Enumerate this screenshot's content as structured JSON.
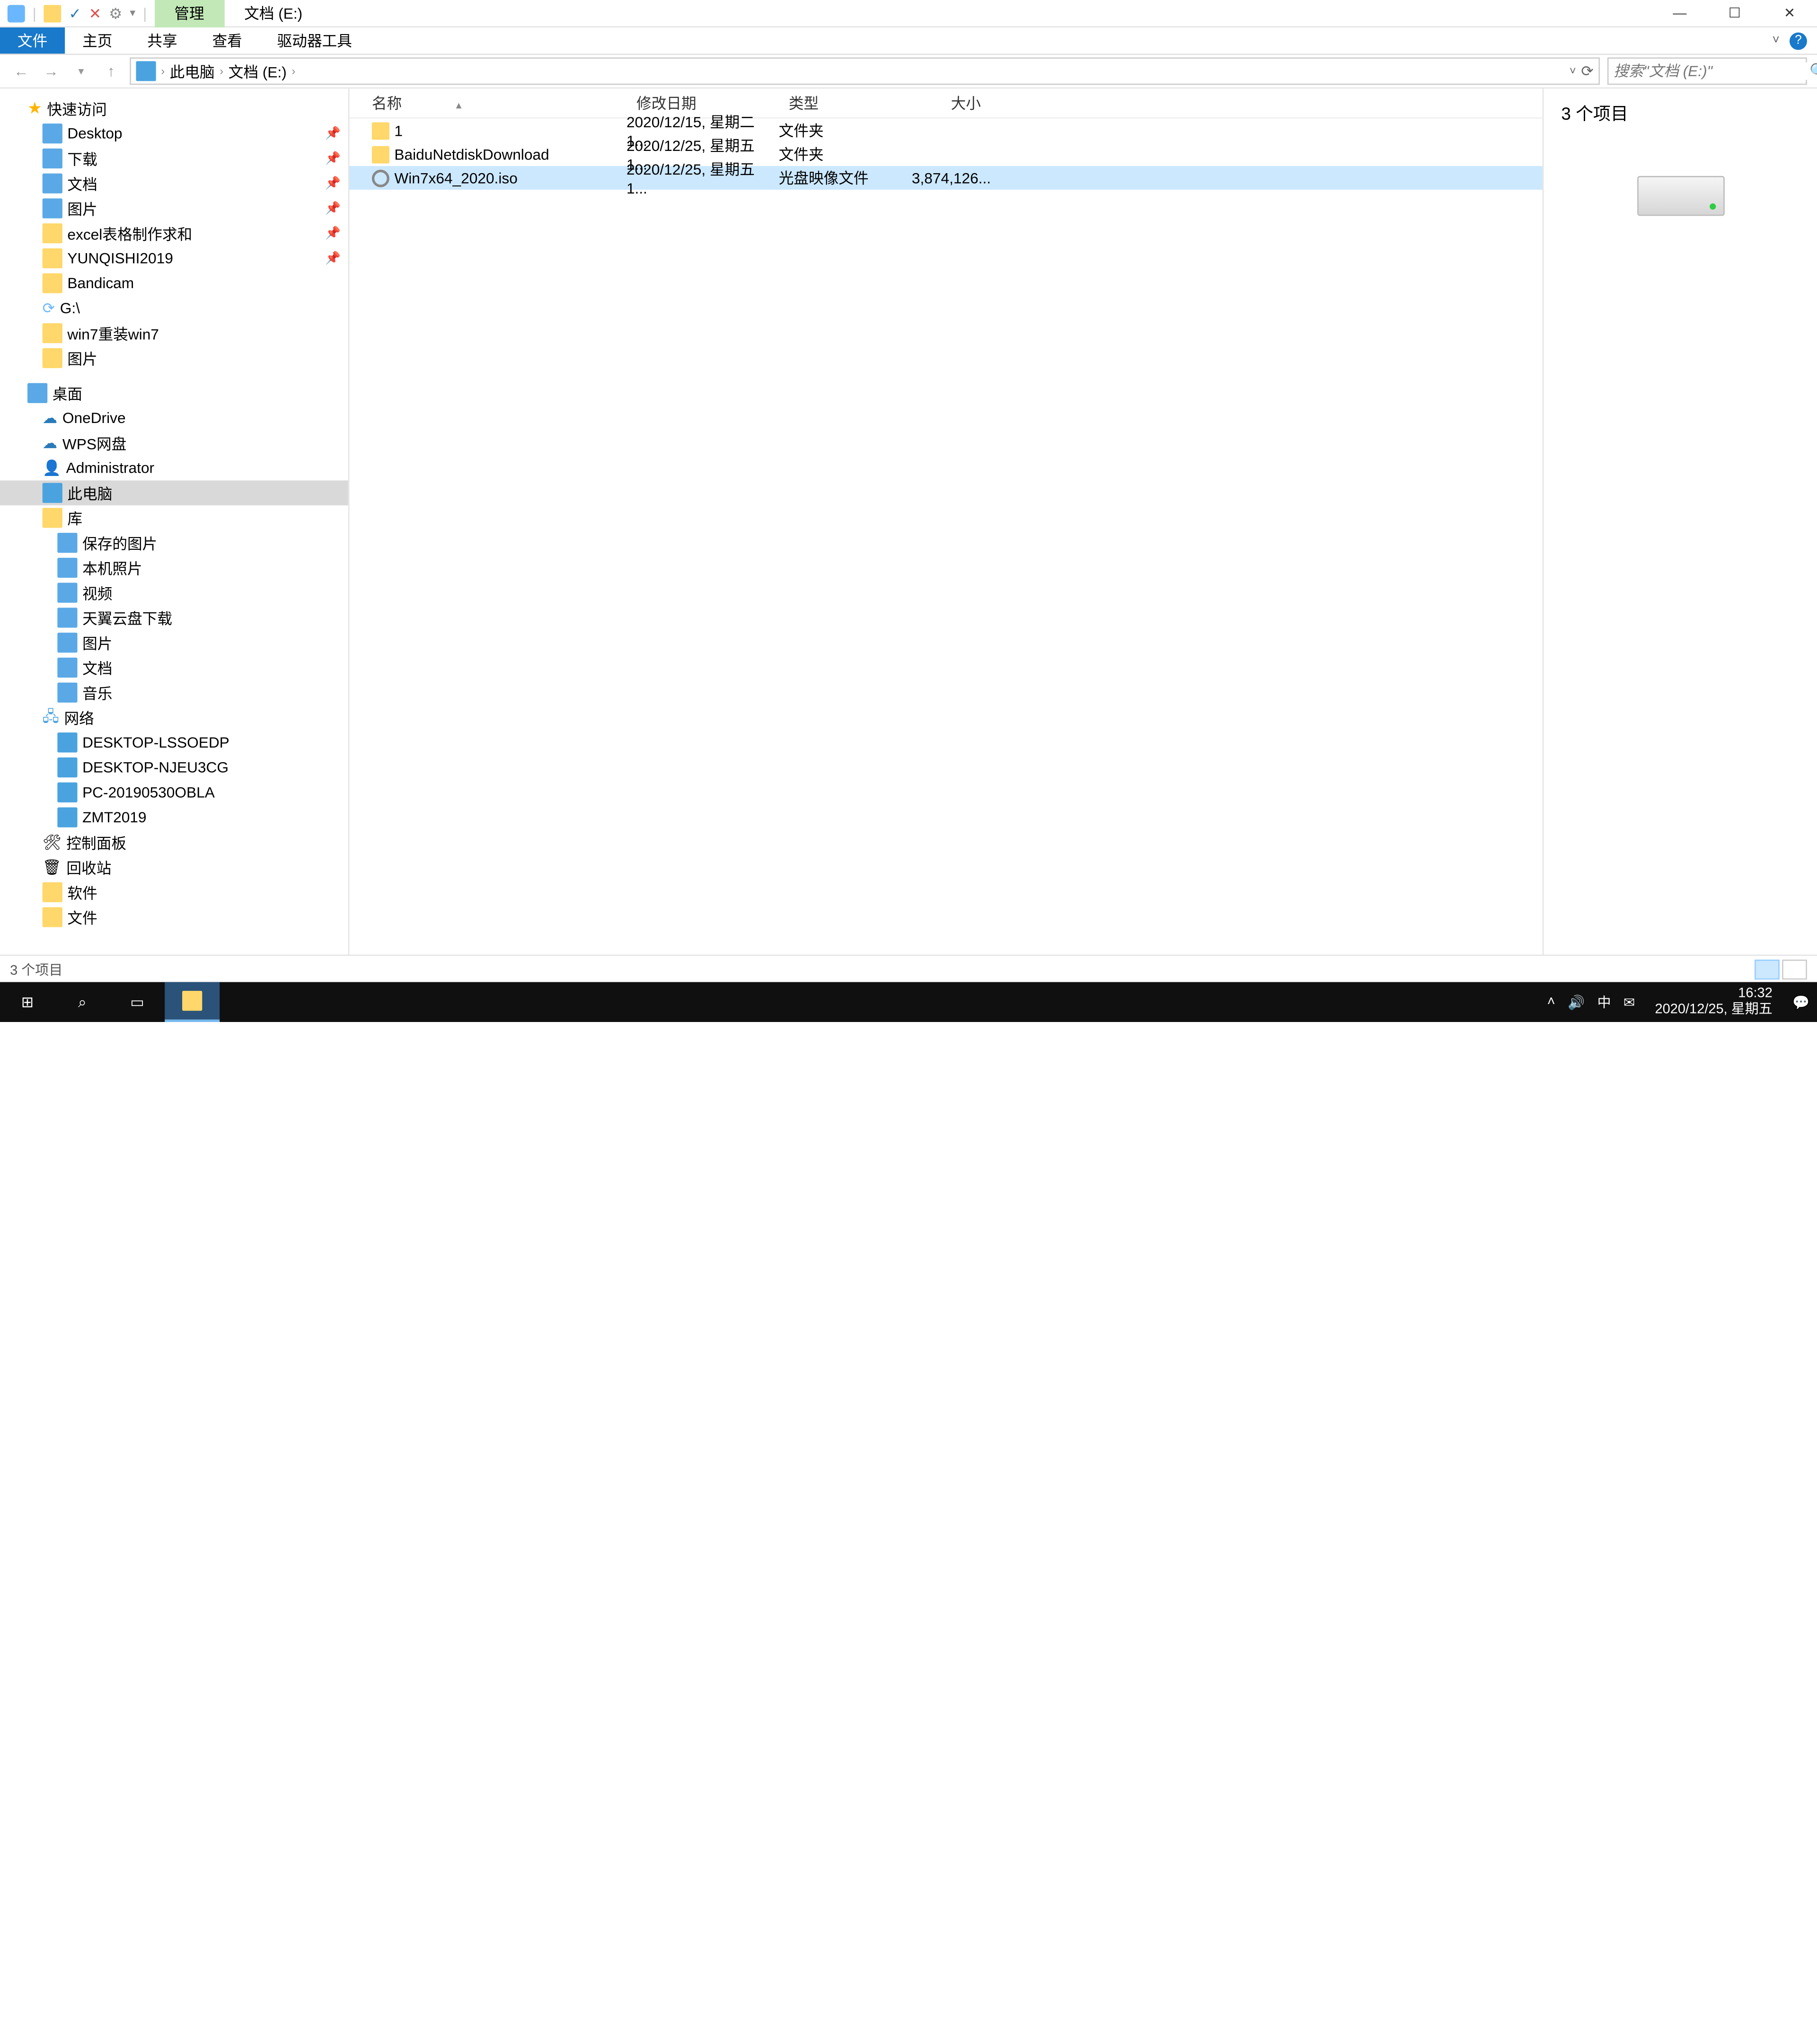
{
  "titlebar": {
    "context_tab": "管理",
    "location_tab": "文档 (E:)"
  },
  "ribbon": {
    "file": "文件",
    "home": "主页",
    "share": "共享",
    "view": "查看",
    "drive_tools": "驱动器工具"
  },
  "address": {
    "crumbs": [
      "此电脑",
      "文档 (E:)"
    ]
  },
  "search": {
    "placeholder": "搜索\"文档 (E:)\""
  },
  "tree": {
    "quick_access": "快速访问",
    "desktop": "Desktop",
    "downloads": "下载",
    "documents": "文档",
    "pictures": "图片",
    "excel": "excel表格制作求和",
    "yunqishi": "YUNQISHI2019",
    "bandicam": "Bandicam",
    "gdrive": "G:\\",
    "win7": "win7重装win7",
    "pictures2": "图片",
    "desktop_root": "桌面",
    "onedrive": "OneDrive",
    "wps": "WPS网盘",
    "admin": "Administrator",
    "thispc": "此电脑",
    "library": "库",
    "saved_pics": "保存的图片",
    "camera_roll": "本机照片",
    "video": "视频",
    "tianyi": "天翼云盘下载",
    "pics_lib": "图片",
    "docs_lib": "文档",
    "music": "音乐",
    "network": "网络",
    "net1": "DESKTOP-LSSOEDP",
    "net2": "DESKTOP-NJEU3CG",
    "net3": "PC-20190530OBLA",
    "net4": "ZMT2019",
    "cpl": "控制面板",
    "recycle": "回收站",
    "soft": "软件",
    "files": "文件"
  },
  "columns": {
    "name": "名称",
    "date": "修改日期",
    "type": "类型",
    "size": "大小"
  },
  "rows": [
    {
      "name": "1",
      "date": "2020/12/15, 星期二 1...",
      "type": "文件夹",
      "size": "",
      "icon": "folder",
      "selected": false
    },
    {
      "name": "BaiduNetdiskDownload",
      "date": "2020/12/25, 星期五 1...",
      "type": "文件夹",
      "size": "",
      "icon": "folder",
      "selected": false
    },
    {
      "name": "Win7x64_2020.iso",
      "date": "2020/12/25, 星期五 1...",
      "type": "光盘映像文件",
      "size": "3,874,126...",
      "icon": "disc",
      "selected": true
    }
  ],
  "preview": {
    "count": "3 个项目"
  },
  "status": {
    "text": "3 个项目"
  },
  "tray": {
    "ime": "中",
    "time": "16:32",
    "date": "2020/12/25, 星期五"
  }
}
